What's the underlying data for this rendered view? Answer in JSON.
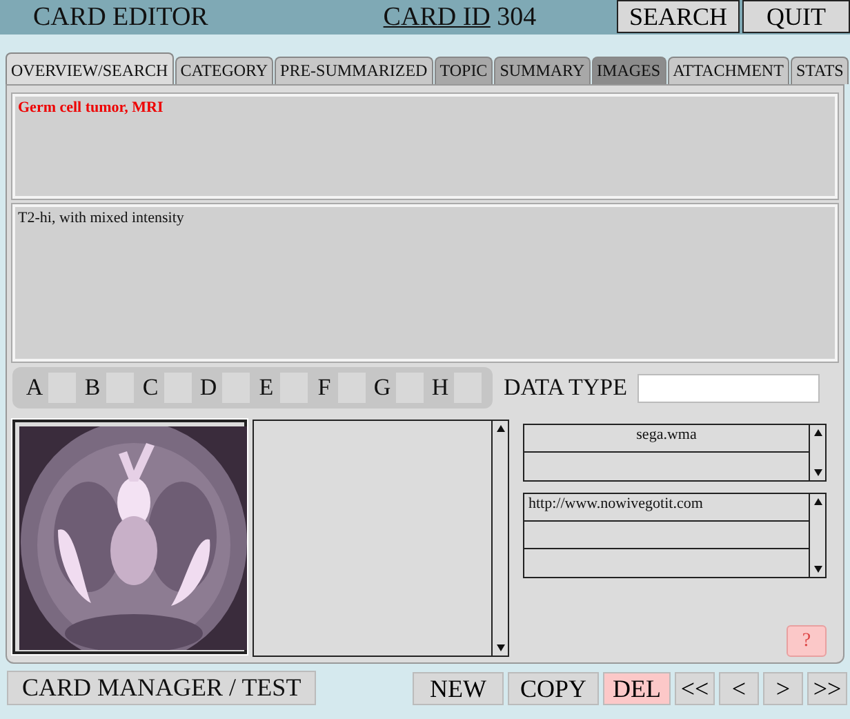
{
  "header": {
    "title": "CARD EDITOR",
    "card_id_label": "CARD ID",
    "card_id": "304",
    "buttons": [
      "SEARCH",
      "QUIT"
    ]
  },
  "tabs": [
    {
      "label": "OVERVIEW/SEARCH",
      "selected": true,
      "color": "#dcdcdc"
    },
    {
      "label": "CATEGORY",
      "selected": false,
      "color": "#c8c8c8"
    },
    {
      "label": "PRE-SUMMARIZED",
      "selected": false,
      "color": "#c8c8c8"
    },
    {
      "label": "TOPIC",
      "selected": false,
      "color": "#a8a8a8"
    },
    {
      "label": "SUMMARY",
      "selected": false,
      "color": "#a8a8a8"
    },
    {
      "label": "IMAGES",
      "selected": false,
      "color": "#8c8c8c"
    },
    {
      "label": "ATTACHMENT",
      "selected": false,
      "color": "#c8c8c8"
    },
    {
      "label": "STATS",
      "selected": false,
      "color": "#c8c8c8"
    }
  ],
  "title_text": "Germ cell tumor, MRI",
  "description_text": "T2-hi, with mixed intensity",
  "letters": [
    "A",
    "B",
    "C",
    "D",
    "E",
    "F",
    "G",
    "H"
  ],
  "data_type": {
    "label": "DATA TYPE"
  },
  "image": {
    "kind": "picture"
  },
  "sound_list": [
    "sega.wma"
  ],
  "link_list": [
    "http://www.nowivegotit.com"
  ],
  "help_button": "?",
  "footer": {
    "title": "CARD MANAGER / TEST",
    "buttons": [
      {
        "label": "NEW",
        "kind": "normal"
      },
      {
        "label": "COPY",
        "kind": "normal"
      },
      {
        "label": "DEL",
        "kind": "danger"
      },
      {
        "label": "<<",
        "kind": "nav"
      },
      {
        "label": "<",
        "kind": "nav"
      },
      {
        "label": ">",
        "kind": "nav"
      },
      {
        "label": ">>",
        "kind": "nav"
      }
    ]
  }
}
